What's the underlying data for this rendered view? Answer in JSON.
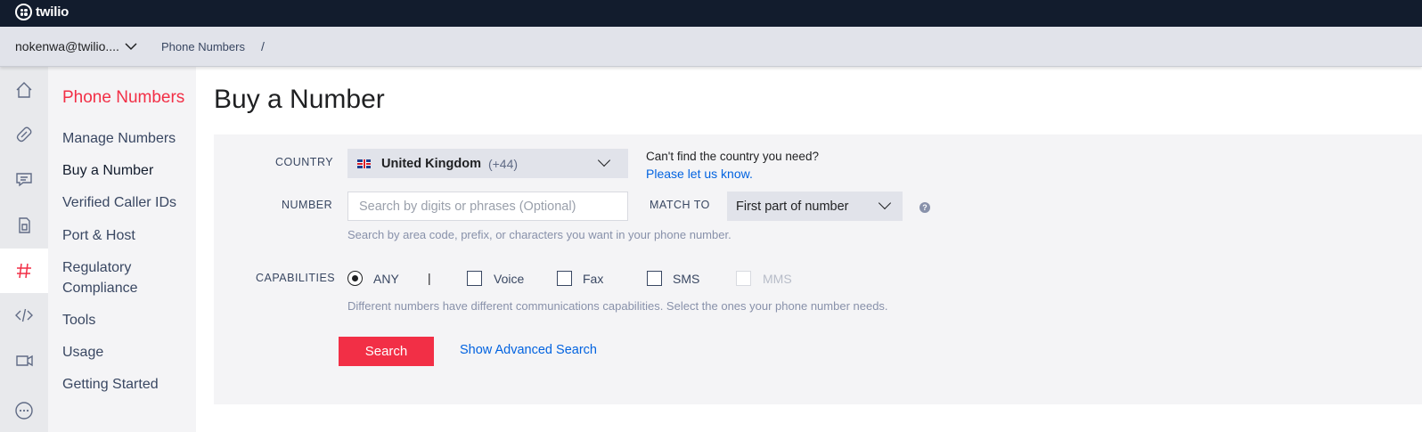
{
  "topbar": {
    "logo_text": "twilio"
  },
  "header": {
    "account": "nokenwa@twilio....",
    "breadcrumb": "Phone Numbers",
    "breadcrumb_separator": "/"
  },
  "rail": {
    "icons": [
      "home-icon",
      "phone-icon",
      "chat-icon",
      "sim-card-icon",
      "hash-icon",
      "code-icon",
      "video-icon",
      "more-icon"
    ],
    "active_icon": "hash-icon",
    "accent": "#f22f46"
  },
  "subnav": {
    "title": "Phone Numbers",
    "items": [
      "Manage Numbers",
      "Buy a Number",
      "Verified Caller IDs",
      "Port & Host",
      "Regulatory Compliance",
      "Tools",
      "Usage",
      "Getting Started"
    ],
    "current": "Buy a Number"
  },
  "main": {
    "title": "Buy a Number",
    "country": {
      "label": "COUNTRY",
      "value": "United Kingdom",
      "code": "(+44)",
      "help": "Can't find the country you need?",
      "help_link": "Please let us know."
    },
    "number": {
      "label": "NUMBER",
      "placeholder": "Search by digits or phrases (Optional)",
      "hint": "Search by area code, prefix, or characters you want in your phone number."
    },
    "match": {
      "label": "MATCH TO",
      "value": "First part of number",
      "help_icon": "?"
    },
    "capabilities": {
      "label": "CAPABILITIES",
      "any": "ANY",
      "divider": "|",
      "options": [
        "Voice",
        "Fax",
        "SMS",
        "MMS"
      ],
      "hint": "Different numbers have different communications capabilities. Select the ones your phone number needs."
    },
    "search_button": "Search",
    "advanced_link": "Show Advanced Search"
  },
  "colors": {
    "topbar": "#121c2d",
    "brand_red": "#f22f46",
    "link_blue": "#0263e0"
  }
}
